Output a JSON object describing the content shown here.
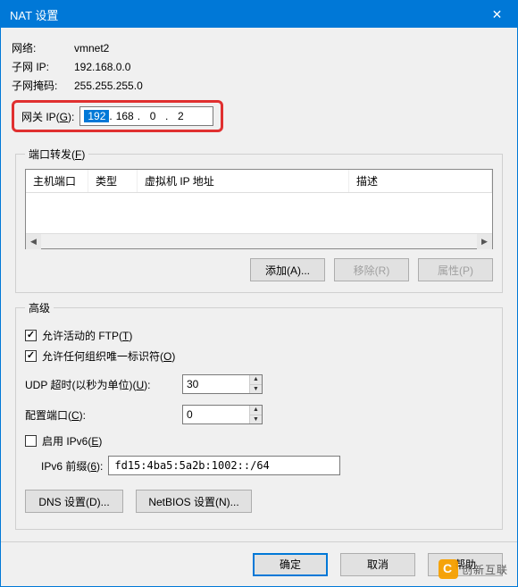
{
  "window": {
    "title": "NAT 设置"
  },
  "info": {
    "network_label": "网络:",
    "network_value": "vmnet2",
    "subnet_ip_label": "子网 IP:",
    "subnet_ip_value": "192.168.0.0",
    "subnet_mask_label": "子网掩码:",
    "subnet_mask_value": "255.255.255.0"
  },
  "gateway": {
    "label_pre": "网关 IP(",
    "label_key": "G",
    "label_post": "):",
    "seg1": "192",
    "seg2": "168",
    "seg3": "0",
    "seg4": "2",
    "dot": "."
  },
  "port_fwd": {
    "legend_pre": "端口转发(",
    "legend_key": "F",
    "legend_post": ")",
    "col_host": "主机端口",
    "col_type": "类型",
    "col_vmip": "虚拟机 IP 地址",
    "col_desc": "描述",
    "btn_add": "添加(A)...",
    "btn_remove": "移除(R)",
    "btn_props": "属性(P)"
  },
  "advanced": {
    "legend": "高级",
    "ftp_pre": "允许活动的 FTP(",
    "ftp_key": "T",
    "ftp_post": ")",
    "oui_pre": "允许任何组织唯一标识符(",
    "oui_key": "O",
    "oui_post": ")",
    "udp_pre": "UDP 超时(以秒为单位)(",
    "udp_key": "U",
    "udp_post": "):",
    "udp_value": "30",
    "cfgport_pre": "配置端口(",
    "cfgport_key": "C",
    "cfgport_post": "):",
    "cfgport_value": "0",
    "ipv6_pre": "启用 IPv6(",
    "ipv6_key": "E",
    "ipv6_post": ")",
    "ipv6prefix_pre": "IPv6 前缀(",
    "ipv6prefix_key": "6",
    "ipv6prefix_post": "):",
    "ipv6prefix_value": "fd15:4ba5:5a2b:1002::/64",
    "btn_dns": "DNS 设置(D)...",
    "btn_netbios": "NetBIOS 设置(N)..."
  },
  "footer": {
    "ok": "确定",
    "cancel": "取消",
    "help": "帮助"
  },
  "watermark": {
    "text": "创新互联"
  }
}
